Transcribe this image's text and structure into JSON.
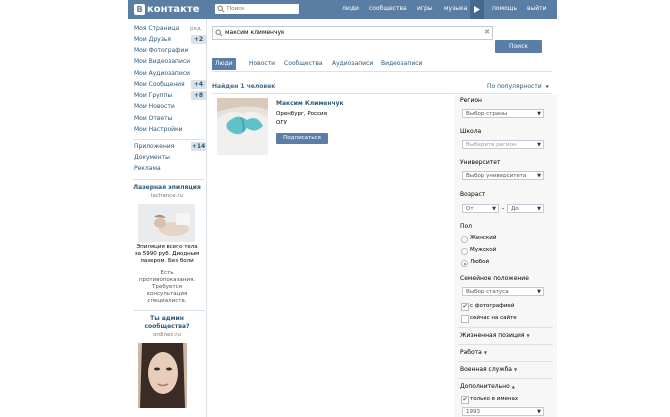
{
  "header": {
    "logo_letter": "В",
    "logo_text": "контакте",
    "search_placeholder": "Поиск",
    "nav": [
      "люди",
      "сообщества",
      "игры",
      "музыка",
      "помощь",
      "выйти"
    ],
    "play_icon": "play-icon"
  },
  "left_menu": {
    "edit_label": "ред.",
    "items": [
      {
        "label": "Моя Страница",
        "count": ""
      },
      {
        "label": "Мои Друзья",
        "count": "+2"
      },
      {
        "label": "Мои Фотографии",
        "count": ""
      },
      {
        "label": "Мои Видеозаписи",
        "count": ""
      },
      {
        "label": "Мои Аудиозаписи",
        "count": ""
      },
      {
        "label": "Мои Сообщения",
        "count": "+4"
      },
      {
        "label": "Мои Группы",
        "count": "+8"
      },
      {
        "label": "Мои Новости",
        "count": ""
      },
      {
        "label": "Мои Ответы",
        "count": ""
      },
      {
        "label": "Мои Настройки",
        "count": ""
      }
    ],
    "extra_items": [
      {
        "label": "Приложения",
        "count": "+14"
      },
      {
        "label": "Документы",
        "count": ""
      },
      {
        "label": "Реклама",
        "count": ""
      }
    ]
  },
  "ads": {
    "ad1_title": "Лазерная эпиляция",
    "ad1_domain": "lachance.ru",
    "ad1_text": [
      "Эпиляция всего тела",
      "за 5990 руб. Диодным",
      "лазером. Без боли"
    ],
    "ad1_warning": [
      "Есть",
      "противопоказания.",
      "Требуется",
      "консультация",
      "специалиста."
    ],
    "ad2_title": [
      "Ты админ",
      "сообщества?"
    ],
    "ad2_domain": "ordinec.ru"
  },
  "search": {
    "query": "максим клименчук",
    "clear_icon": "✖",
    "button_label": "Поиск"
  },
  "tabs": [
    "Люди",
    "Новости",
    "Сообщества",
    "Аудиозаписи",
    "Видеозаписи"
  ],
  "results": {
    "found_label": "Найден 1 человек",
    "sort_label": "По популярности",
    "person": {
      "name": "Максим Клименчук",
      "location": "Оренбург, Россия",
      "school": "ОГУ",
      "subscribe_label": "Подписаться"
    }
  },
  "filters": {
    "region_label": "Регион",
    "region_value": "Выбор страны",
    "school_label": "Школа",
    "school_value": "Выберите регион",
    "university_label": "Университет",
    "university_value": "Выбор университета",
    "age_label": "Возраст",
    "age_from": "От",
    "age_dash": "-",
    "age_to": "До",
    "sex_label": "Пол",
    "sex_options": [
      "Женский",
      "Мужской",
      "Любой"
    ],
    "sex_selected_index": 2,
    "marital_label": "Семейное положение",
    "marital_value": "Выбор статуса",
    "with_photo_label": "с фотографией",
    "with_photo_checked": true,
    "online_label": "сейчас на сайте",
    "online_checked": false,
    "life_position_label": "Жизненная позиция",
    "work_label": "Работа",
    "military_label": "Военная служба",
    "extra_label": "Дополнительно",
    "names_only_label": "только в именах",
    "names_only_checked": true,
    "year_value": "1993"
  }
}
